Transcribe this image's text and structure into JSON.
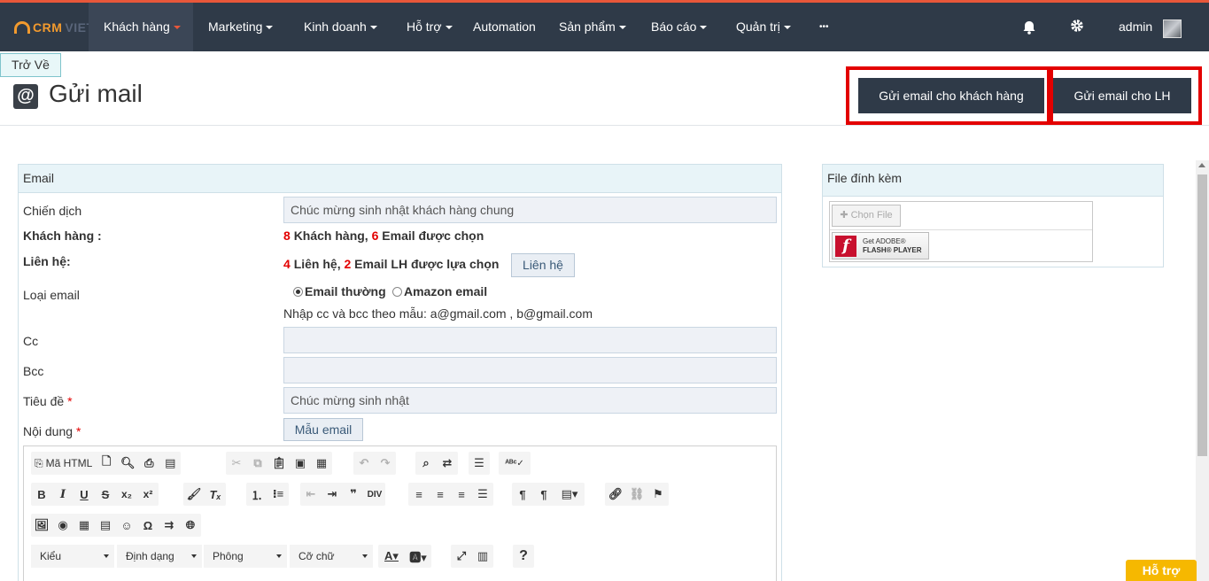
{
  "nav": {
    "logo_crm": "CRM",
    "logo_viet": "VIET",
    "items": [
      {
        "label": "Khách hàng",
        "caret": true
      },
      {
        "label": "Marketing",
        "caret": true
      },
      {
        "label": "Kinh doanh",
        "caret": true
      },
      {
        "label": "Hỗ trợ",
        "caret": true
      },
      {
        "label": "Automation",
        "caret": false
      },
      {
        "label": "Sản phẩm",
        "caret": true
      },
      {
        "label": "Báo cáo",
        "caret": true
      },
      {
        "label": "Quản trị",
        "caret": true
      },
      {
        "label": "•••",
        "caret": false
      }
    ],
    "user": "admin",
    "icons": [
      "bell-icon",
      "gear-icon"
    ]
  },
  "header": {
    "back_label": "Trở Về",
    "title_icon": "@",
    "title": "Gửi mail",
    "btn_send_customers": "Gửi email cho khách hàng",
    "btn_send_contacts": "Gửi email cho LH",
    "highlight_color": "#e30000"
  },
  "email": {
    "panel_title": "Email",
    "campaign_label": "Chiến dịch",
    "campaign_value": "Chúc mừng sinh nhật khách hàng chung",
    "customer_label": "Khách hàng :",
    "customer_count": "8",
    "customer_text": "Khách hàng,",
    "customer_email_count": "6",
    "customer_email_text": "Email được chọn",
    "contact_label": "Liên hệ:",
    "contact_count": "4",
    "contact_text": "Liên hệ,",
    "contact_email_count": "2",
    "contact_email_text": "Email LH được lựa chọn",
    "contact_button": "Liên hệ",
    "email_type_label": "Loại email",
    "email_type_options": [
      "Email thường",
      "Amazon email"
    ],
    "email_type_selected": "Email thường",
    "cc_hint": "Nhập cc và bcc theo mẫu: a@gmail.com , b@gmail.com",
    "cc_label": "Cc",
    "cc_value": "",
    "bcc_label": "Bcc",
    "bcc_value": "",
    "subject_label": "Tiêu đề",
    "subject_value": "Chúc mừng sinh nhật",
    "content_label": "Nội dung",
    "template_button": "Mẫu email",
    "required_mark": "*"
  },
  "editor": {
    "source_label": "Mã HTML",
    "combos": [
      "Kiểu",
      "Định dạng",
      "Phông",
      "Cỡ chữ"
    ]
  },
  "attach": {
    "panel_title": "File đính kèm",
    "choose_file": "Chọn File",
    "flash_line1": "Get ADOBE®",
    "flash_line2": "FLASH® PLAYER"
  },
  "help_button": "Hỗ trợ",
  "colors": {
    "nav_bg": "#2f3a48",
    "accent": "#e8573a",
    "required": "#e30000",
    "help": "#f6b800"
  }
}
